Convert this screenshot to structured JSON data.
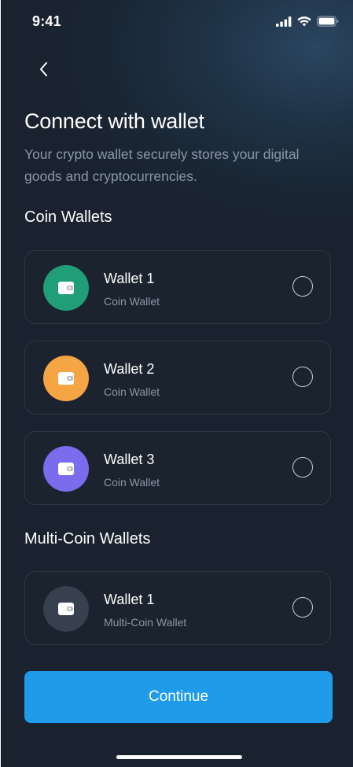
{
  "status_bar": {
    "time": "9:41"
  },
  "header": {
    "title": "Connect with wallet",
    "subtitle": "Your crypto wallet securely stores your digital goods and cryptocurrencies."
  },
  "sections": {
    "coin": {
      "title": "Coin Wallets",
      "wallets": [
        {
          "name": "Wallet 1",
          "type": "Coin Wallet",
          "color": "#1f9e77"
        },
        {
          "name": "Wallet 2",
          "type": "Coin Wallet",
          "color": "#f6a544"
        },
        {
          "name": "Wallet 3",
          "type": "Coin Wallet",
          "color": "#7a6cec"
        }
      ]
    },
    "multi": {
      "title": "Multi-Coin Wallets",
      "wallets": [
        {
          "name": "Wallet 1",
          "type": "Multi-Coin Wallet",
          "color": "#36404e"
        }
      ]
    }
  },
  "footer": {
    "continue_label": "Continue"
  },
  "colors": {
    "background": "#19222e",
    "accent": "#1e9be9",
    "muted_text": "#8b97a6"
  }
}
